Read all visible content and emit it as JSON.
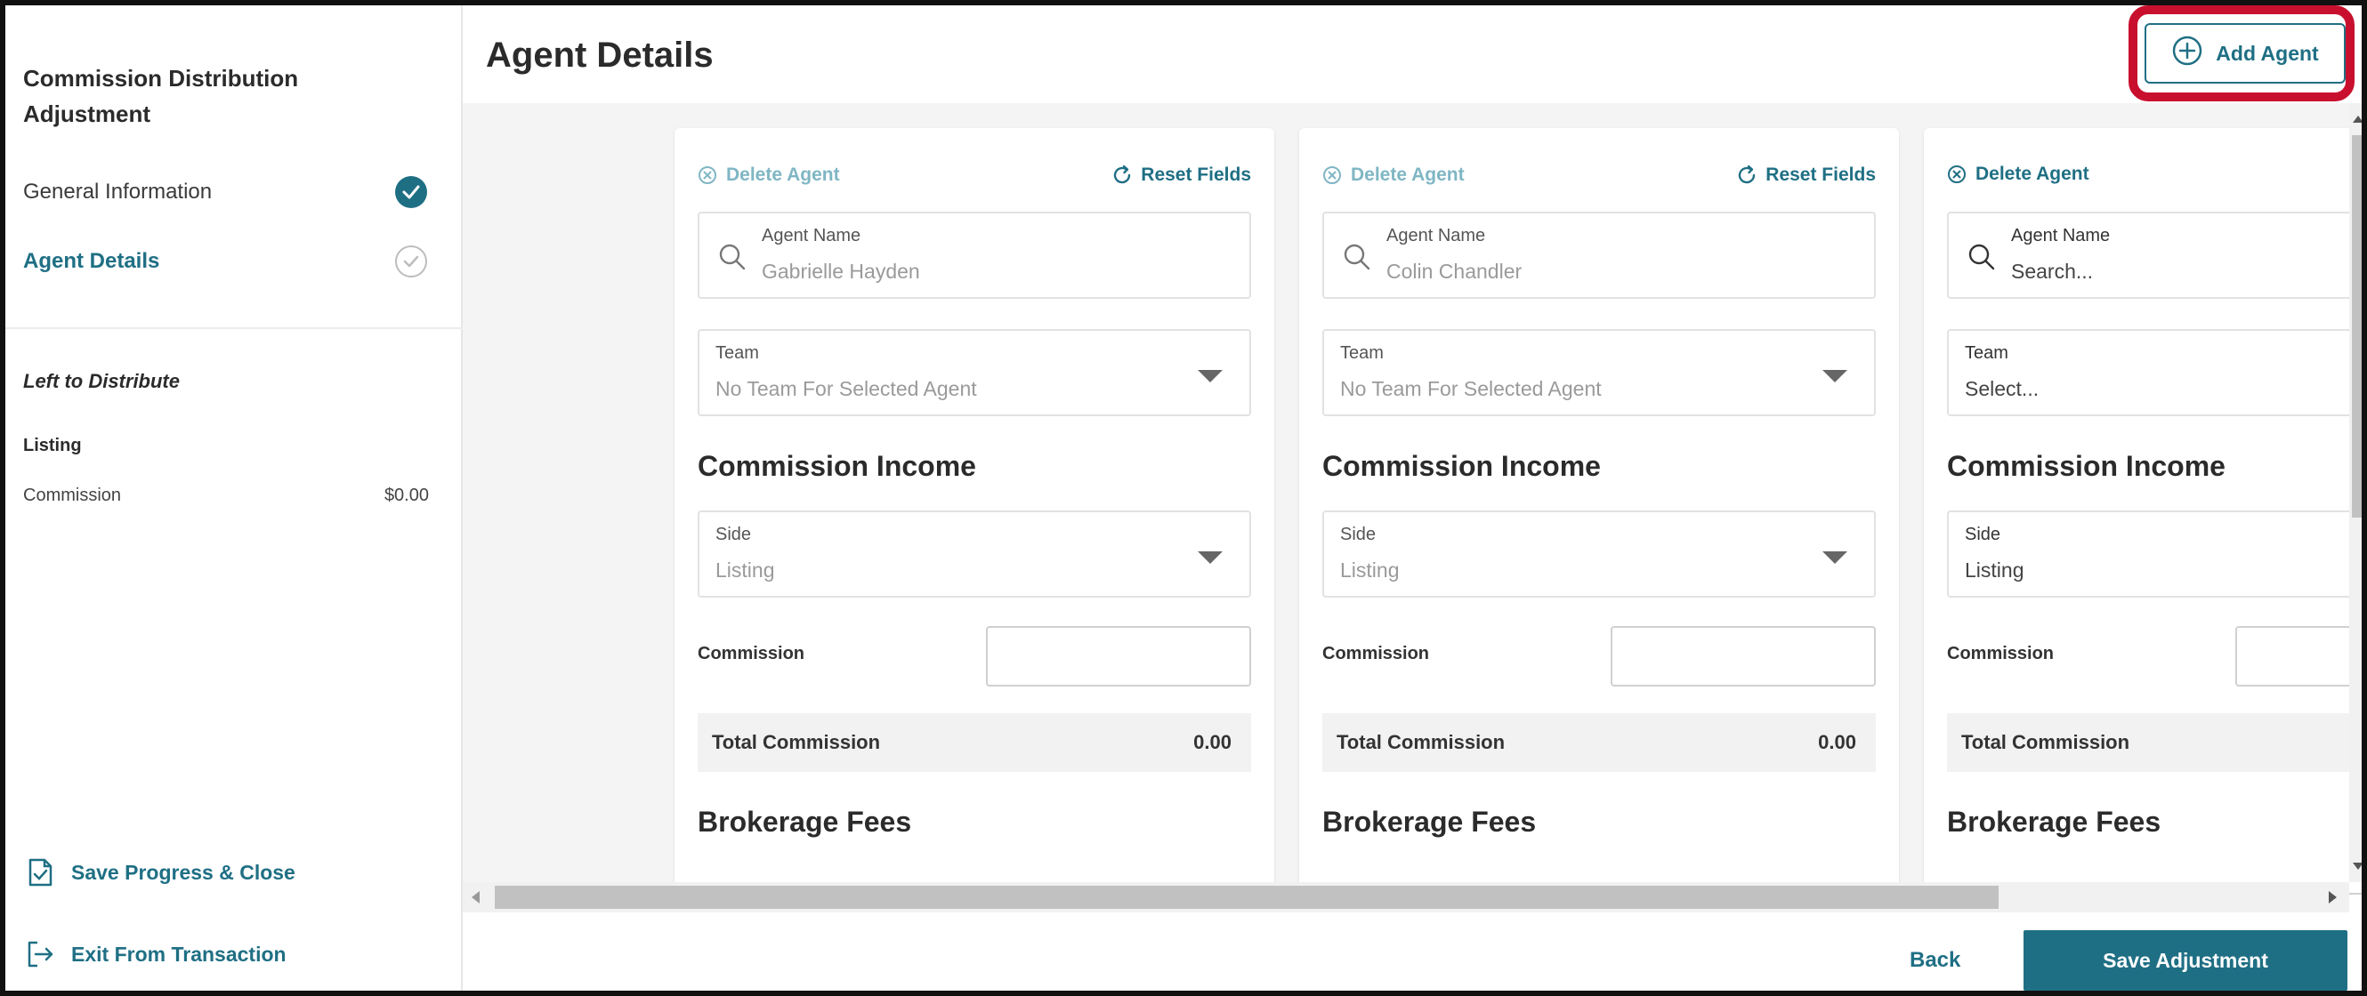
{
  "sidebar": {
    "title": "Commission Distribution Adjustment",
    "steps": [
      {
        "label": "General Information",
        "state": "done"
      },
      {
        "label": "Agent Details",
        "state": "active"
      }
    ],
    "left_to_distribute": "Left to Distribute",
    "listing_label": "Listing",
    "commission_label": "Commission",
    "commission_value": "$0.00",
    "save_progress": "Save Progress & Close",
    "exit": "Exit From Transaction"
  },
  "header": {
    "title": "Agent Details",
    "add_agent": "Add Agent"
  },
  "cards": [
    {
      "delete_label": "Delete Agent",
      "reset_label": "Reset Fields",
      "agent_name_label": "Agent Name",
      "agent_name_value": "Gabrielle Hayden",
      "team_label": "Team",
      "team_value": "No Team For Selected Agent",
      "commission_income_heading": "Commission Income",
      "side_label": "Side",
      "side_value": "Listing",
      "commission_label": "Commission",
      "total_commission_label": "Total Commission",
      "total_commission_value": "0.00",
      "brokerage_fees_heading": "Brokerage Fees"
    },
    {
      "delete_label": "Delete Agent",
      "reset_label": "Reset Fields",
      "agent_name_label": "Agent Name",
      "agent_name_value": "Colin Chandler",
      "team_label": "Team",
      "team_value": "No Team For Selected Agent",
      "commission_income_heading": "Commission Income",
      "side_label": "Side",
      "side_value": "Listing",
      "commission_label": "Commission",
      "total_commission_label": "Total Commission",
      "total_commission_value": "0.00",
      "brokerage_fees_heading": "Brokerage Fees"
    },
    {
      "delete_label": "Delete Agent",
      "agent_name_label": "Agent Name",
      "agent_name_placeholder": "Search...",
      "team_label": "Team",
      "team_placeholder": "Select...",
      "commission_income_heading": "Commission Income",
      "side_label": "Side",
      "side_value": "Listing",
      "commission_label": "Commission",
      "total_commission_label": "Total Commission",
      "brokerage_fees_heading": "Brokerage Fees"
    }
  ],
  "footer": {
    "back": "Back",
    "save": "Save Adjustment"
  },
  "colors": {
    "accent": "#1f6f84",
    "highlight": "#c8102e"
  }
}
